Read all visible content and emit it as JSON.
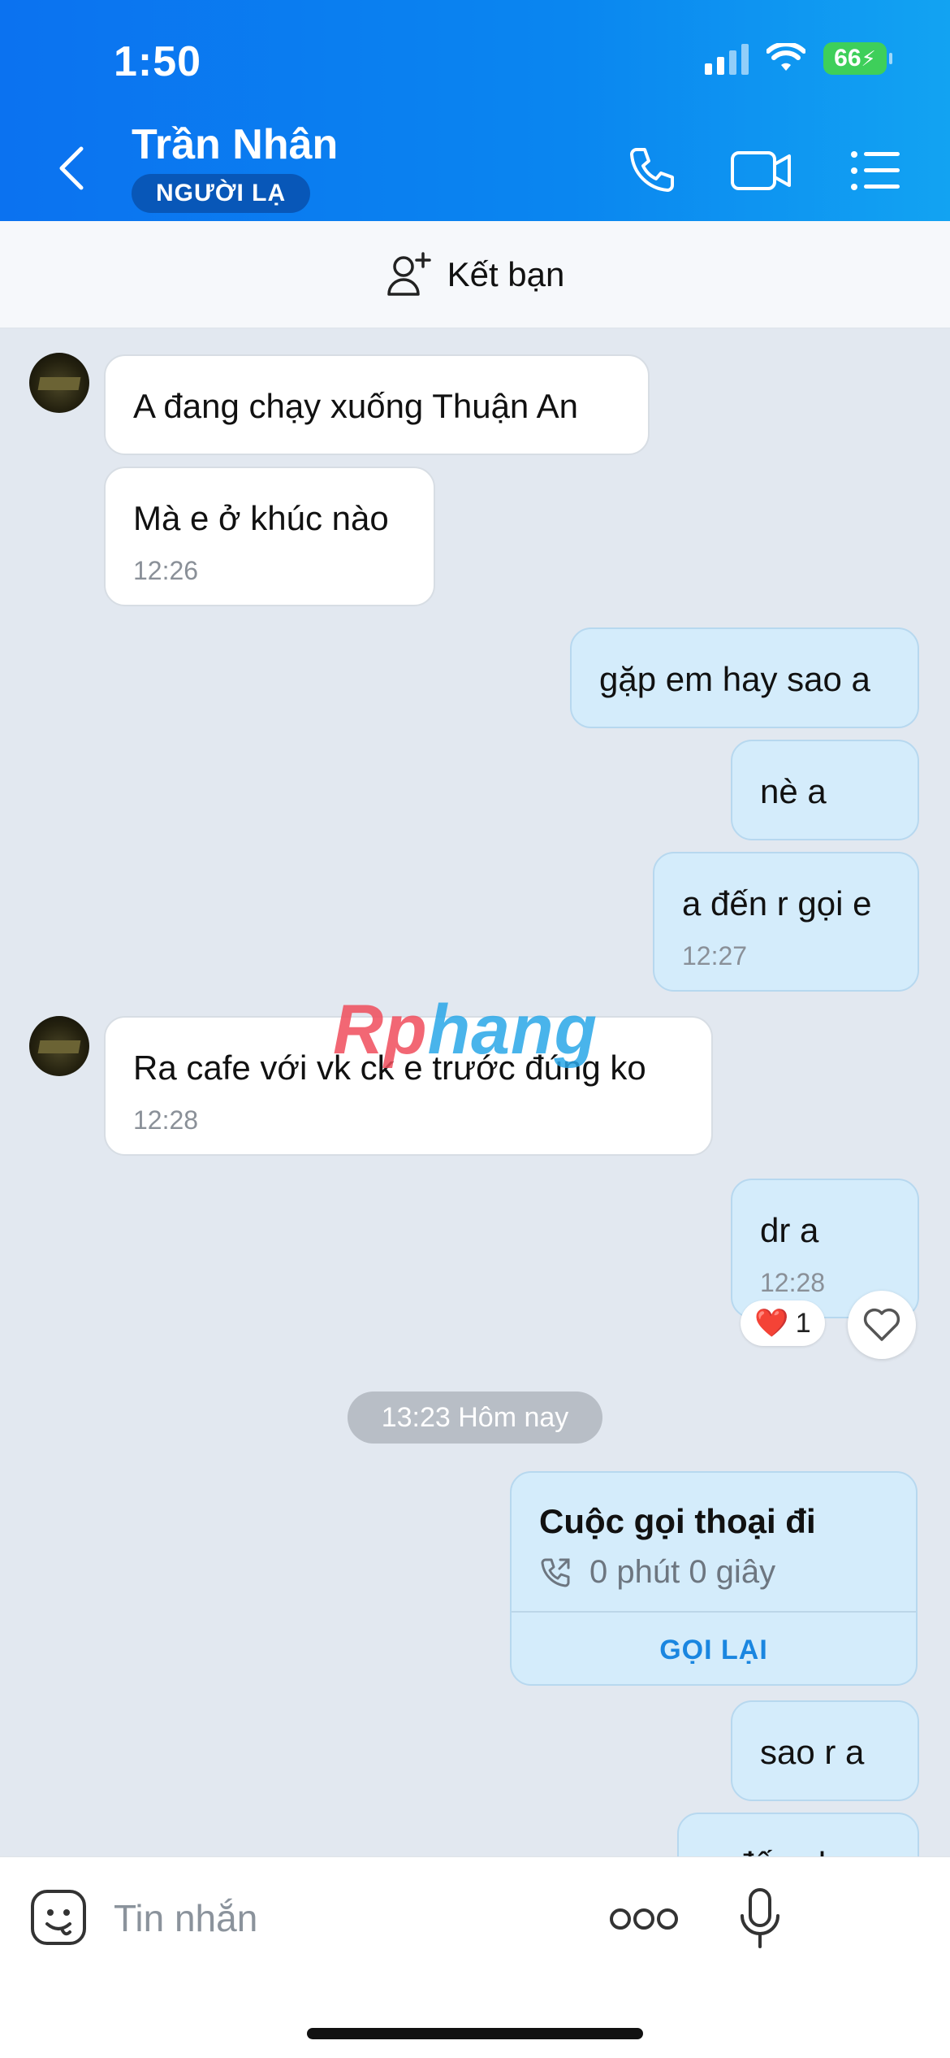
{
  "status_bar": {
    "time": "1:50",
    "battery": "66"
  },
  "header": {
    "contact_name": "Trần Nhân",
    "badge": "NGƯỜI LẠ",
    "icons": [
      "back-icon",
      "phone-icon",
      "video-icon",
      "menu-icon"
    ]
  },
  "add_friend": {
    "label": "Kết bạn"
  },
  "messages": [
    {
      "dir": "in",
      "text": "A đang chạy xuống Thuận An",
      "time": ""
    },
    {
      "dir": "in",
      "text": "Mà e ở khúc nào",
      "time": "12:26"
    },
    {
      "dir": "out",
      "text": "gặp em hay sao a",
      "time": ""
    },
    {
      "dir": "out",
      "text": "nè a",
      "time": ""
    },
    {
      "dir": "out",
      "text": "a đến r gọi e",
      "time": "12:27"
    },
    {
      "dir": "in",
      "text": "Ra cafe với vk ck e trước đúng ko",
      "time": "12:28"
    },
    {
      "dir": "out",
      "text": "dr a",
      "time": "12:28"
    },
    {
      "dir": "out",
      "text": "sao r a",
      "time": ""
    },
    {
      "dir": "out",
      "text": "a đến chưa",
      "time": ""
    }
  ],
  "reaction": {
    "emoji": "❤️",
    "count": "1"
  },
  "date_separator": "13:23 Hôm nay",
  "call_card": {
    "title": "Cuộc gọi thoại đi",
    "duration": "0 phút 0 giây",
    "action": "GỌI LẠI"
  },
  "watermark": {
    "part1": "Rp",
    "part2": "hang"
  },
  "composer": {
    "placeholder": "Tin nhắn"
  }
}
